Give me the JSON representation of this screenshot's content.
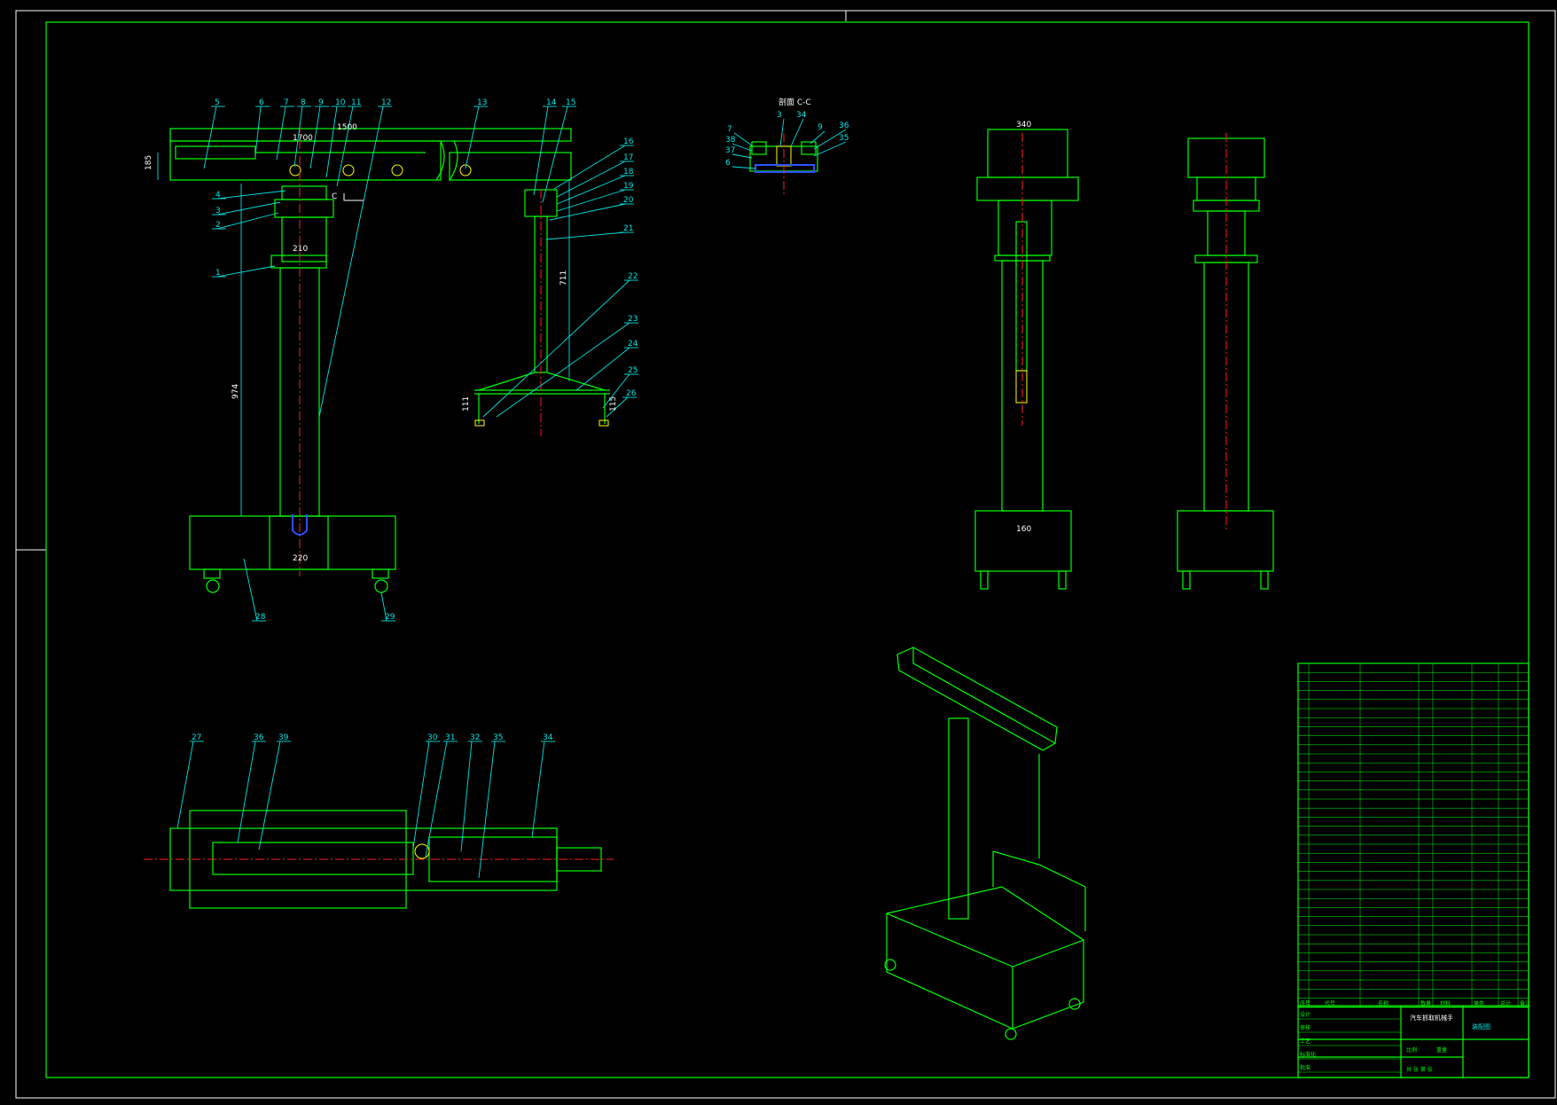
{
  "colors": {
    "background": "#000000",
    "frame": "#ffffff",
    "outline": "#00ff00",
    "leader": "#00e5e5",
    "centerline": "#ff2020",
    "highlight": "#ffff00",
    "detail": "#3050ff"
  },
  "section_title": "剖面 C-C",
  "section_mark": "C",
  "dimensions": {
    "arm_reach_a": "1500",
    "arm_reach_b": "1700",
    "arm_height": "185",
    "hub_width": "210",
    "column_height": "974",
    "base_width": "220",
    "lift_height": "711",
    "gripper_height": "111",
    "gripper_offset": "115",
    "side_width": "160",
    "top_width": "340"
  },
  "front_view_callouts": [
    "5",
    "6",
    "7",
    "8",
    "9",
    "10",
    "11",
    "12",
    "13",
    "14",
    "15",
    "16",
    "17",
    "18",
    "19",
    "20",
    "21",
    "22",
    "23",
    "24",
    "25",
    "26",
    "4",
    "3",
    "2",
    "1",
    "28",
    "29"
  ],
  "bottom_wheel_callouts": [
    "28",
    "29"
  ],
  "plan_view_callouts": [
    "27",
    "36",
    "39",
    "30",
    "31",
    "32",
    "35",
    "34"
  ],
  "section_callouts": [
    "7",
    "38",
    "37",
    "6",
    "3",
    "34",
    "9",
    "36",
    "35"
  ],
  "title_block": {
    "sheet_title": "汽车抓取机械手",
    "drawing_name": "装配图",
    "rows": [
      "设计",
      "审核",
      "工艺",
      "标准化",
      "批准"
    ],
    "columns_header": [
      "序号",
      "代号",
      "名称",
      "数量",
      "材料",
      "单件",
      "总计",
      "备注"
    ],
    "scale_label": "比例",
    "weight_label": "重量",
    "sheet_label": "共  张  第  张"
  }
}
